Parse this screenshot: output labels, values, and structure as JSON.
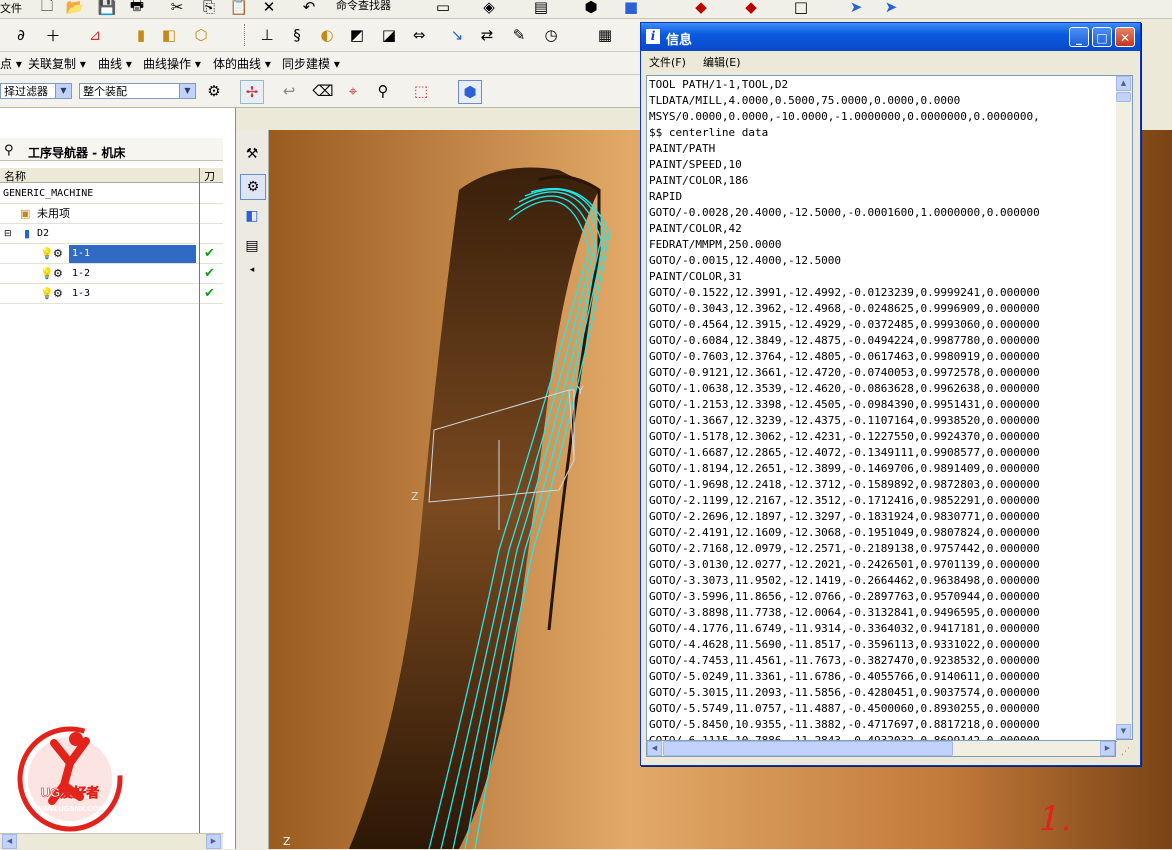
{
  "toolbar_menu": {
    "partial_left": "文件",
    "items": [
      "点",
      "关联复制",
      "曲线",
      "曲线操作",
      "体的曲线",
      "同步建模"
    ],
    "command_finder": "命令查找器"
  },
  "selection_bar": {
    "filter_value": "择过滤器",
    "assembly_value": "整个装配"
  },
  "navigator": {
    "title": "工序导航器 - 机床",
    "col_name": "名称",
    "col_tool": "刀",
    "machine": "GENERIC_MACHINE",
    "unused": "未用项",
    "tool": "D2",
    "operations": [
      {
        "name": "1-1",
        "selected": true,
        "status": "complete"
      },
      {
        "name": "1-2",
        "selected": false,
        "status": "complete"
      },
      {
        "name": "1-3",
        "selected": false,
        "status": "complete"
      }
    ]
  },
  "viewport": {
    "axis_y": "Y",
    "axis_z": "Z",
    "axis_z2": "Z",
    "annotation": "1."
  },
  "info_window": {
    "title": "信息",
    "menu_file": "文件(F)",
    "menu_edit": "编辑(E)",
    "lines": [
      "TOOL PATH/1-1,TOOL,D2",
      "TLDATA/MILL,4.0000,0.5000,75.0000,0.0000,0.0000",
      "MSYS/0.0000,0.0000,-10.0000,-1.0000000,0.0000000,0.0000000,",
      "$$ centerline data",
      "PAINT/PATH",
      "PAINT/SPEED,10",
      "PAINT/COLOR,186",
      "RAPID",
      "GOTO/-0.0028,20.4000,-12.5000,-0.0001600,1.0000000,0.000000",
      "PAINT/COLOR,42",
      "FEDRAT/MMPM,250.0000",
      "GOTO/-0.0015,12.4000,-12.5000",
      "PAINT/COLOR,31",
      "GOTO/-0.1522,12.3991,-12.4992,-0.0123239,0.9999241,0.000000",
      "GOTO/-0.3043,12.3962,-12.4968,-0.0248625,0.9996909,0.000000",
      "GOTO/-0.4564,12.3915,-12.4929,-0.0372485,0.9993060,0.000000",
      "GOTO/-0.6084,12.3849,-12.4875,-0.0494224,0.9987780,0.000000",
      "GOTO/-0.7603,12.3764,-12.4805,-0.0617463,0.9980919,0.000000",
      "GOTO/-0.9121,12.3661,-12.4720,-0.0740053,0.9972578,0.000000",
      "GOTO/-1.0638,12.3539,-12.4620,-0.0863628,0.9962638,0.000000",
      "GOTO/-1.2153,12.3398,-12.4505,-0.0984390,0.9951431,0.000000",
      "GOTO/-1.3667,12.3239,-12.4375,-0.1107164,0.9938520,0.000000",
      "GOTO/-1.5178,12.3062,-12.4231,-0.1227550,0.9924370,0.000000",
      "GOTO/-1.6687,12.2865,-12.4072,-0.1349111,0.9908577,0.000000",
      "GOTO/-1.8194,12.2651,-12.3899,-0.1469706,0.9891409,0.000000",
      "GOTO/-1.9698,12.2418,-12.3712,-0.1589892,0.9872803,0.000000",
      "GOTO/-2.1199,12.2167,-12.3512,-0.1712416,0.9852291,0.000000",
      "GOTO/-2.2696,12.1897,-12.3297,-0.1831924,0.9830771,0.000000",
      "GOTO/-2.4191,12.1609,-12.3068,-0.1951049,0.9807824,0.000000",
      "GOTO/-2.7168,12.0979,-12.2571,-0.2189138,0.9757442,0.000000",
      "GOTO/-3.0130,12.0277,-12.2021,-0.2426501,0.9701139,0.000000",
      "GOTO/-3.3073,11.9502,-12.1419,-0.2664462,0.9638498,0.000000",
      "GOTO/-3.5996,11.8656,-12.0766,-0.2897763,0.9570944,0.000000",
      "GOTO/-3.8898,11.7738,-12.0064,-0.3132841,0.9496595,0.000000",
      "GOTO/-4.1776,11.6749,-11.9314,-0.3364032,0.9417181,0.000000",
      "GOTO/-4.4628,11.5690,-11.8517,-0.3596113,0.9331022,0.000000",
      "GOTO/-4.7453,11.4561,-11.7673,-0.3827470,0.9238532,0.000000",
      "GOTO/-5.0249,11.3361,-11.6786,-0.4055766,0.9140611,0.000000",
      "GOTO/-5.3015,11.2093,-11.5856,-0.4280451,0.9037574,0.000000",
      "GOTO/-5.5749,11.0757,-11.4887,-0.4500060,0.8930255,0.000000",
      "GOTO/-5.8450,10.9355,-11.3882,-0.4717697,0.8817218,0.000000",
      "GOTO/-6.1115,10.7886,-11.2843,-0.4932032,0.8699142,0.000000"
    ]
  },
  "logo": {
    "brand": "UG爱好者",
    "url": "WWW.UGSNX.COM"
  },
  "colors": {
    "selection": "#316ac5",
    "titlebar": "#0b5be0",
    "toolpath": "#1ee7ee",
    "part": "#c27a3a",
    "logo_red": "#e3231b"
  }
}
